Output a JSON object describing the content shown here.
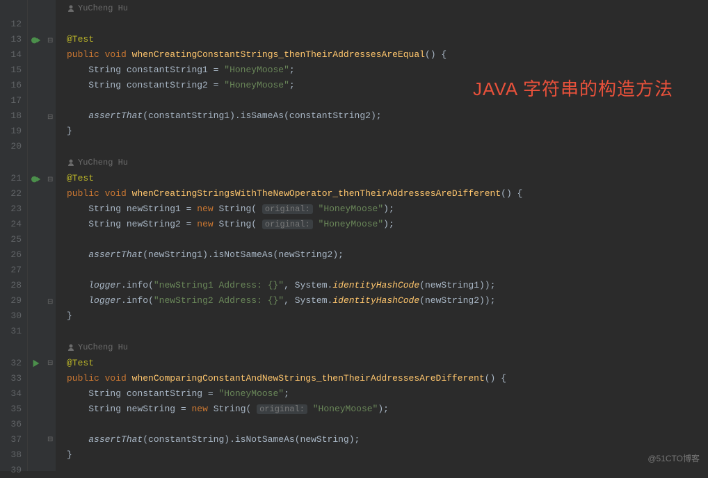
{
  "annotations": {
    "author1": "YuCheng Hu",
    "author2": "YuCheng Hu",
    "author3": "YuCheng Hu",
    "test": "@Test"
  },
  "code": {
    "public": "public",
    "void": "void",
    "new": "new",
    "string_t": "String",
    "m1": "whenCreatingConstantStrings_thenTheirAddressesAreEqual",
    "m2": "whenCreatingStringsWithTheNewOperator_thenTheirAddressesAreDifferent",
    "m3": "whenComparingConstantAndNewStrings_thenTheirAddressesAreDifferent",
    "cs1": "constantString1",
    "cs2": "constantString2",
    "cs": "constantString",
    "ns1": "newString1",
    "ns2": "newString2",
    "ns": "newString",
    "honey": "\"HoneyMoose\"",
    "assertThat": "assertThat",
    "isSameAs": "isSameAs",
    "isNotSameAs": "isNotSameAs",
    "logger": "logger",
    "info": "info",
    "log1": "\"newString1 Address: {}\"",
    "log2": "\"newString2 Address: {}\"",
    "system": "System",
    "idhash": "identityHashCode",
    "hint_original": "original:"
  },
  "line_numbers": [
    "12",
    "13",
    "14",
    "15",
    "16",
    "17",
    "18",
    "19",
    "20",
    "21",
    "22",
    "23",
    "24",
    "25",
    "26",
    "27",
    "28",
    "29",
    "30",
    "31",
    "32",
    "33",
    "34",
    "35",
    "36",
    "37",
    "38",
    "39"
  ],
  "overlay": {
    "title": "JAVA 字符串的构造方法",
    "watermark": "@51CTO博客"
  }
}
